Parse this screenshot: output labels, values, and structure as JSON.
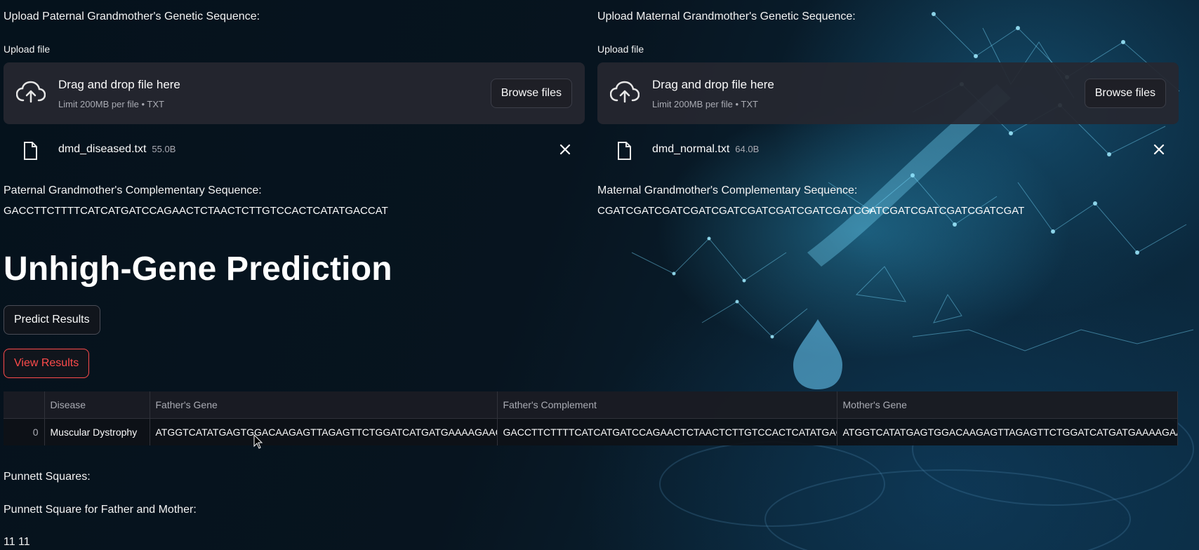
{
  "left": {
    "heading": "Upload Paternal Grandmother's Genetic Sequence:",
    "upload_label": "Upload file",
    "drop_title": "Drag and drop file here",
    "drop_sub": "Limit 200MB per file • TXT",
    "browse_label": "Browse files",
    "file_name": "dmd_diseased.txt",
    "file_size": "55.0B",
    "comp_label": "Paternal Grandmother's Complementary Sequence:",
    "comp_seq": "GACCTTCTTTTCATCATGATCCAGAACTCTAACTCTTGTCCACTCATATGACCAT"
  },
  "right": {
    "heading": "Upload Maternal Grandmother's Genetic Sequence:",
    "upload_label": "Upload file",
    "drop_title": "Drag and drop file here",
    "drop_sub": "Limit 200MB per file • TXT",
    "browse_label": "Browse files",
    "file_name": "dmd_normal.txt",
    "file_size": "64.0B",
    "comp_label": "Maternal Grandmother's Complementary Sequence:",
    "comp_seq": "CGATCGATCGATCGATCGATCGATCGATCGATCGATCGATCGATCGATCGATCGATCGAT"
  },
  "title": "Unhigh-Gene Prediction",
  "buttons": {
    "predict": "Predict Results",
    "view": "View Results"
  },
  "table": {
    "columns": [
      "",
      "Disease",
      "Father's Gene",
      "Father's Complement",
      "Mother's Gene"
    ],
    "rows": [
      [
        "0",
        "Muscular Dystrophy",
        "ATGGTCATATGAGTGGACAAGAGTTAGAGTTCTGGATCATGATGAAAAGAAGGTC",
        "GACCTTCTTTTCATCATGATCCAGAACTCTAACTCTTGTCCACTCATATGACCAT",
        "ATGGTCATATGAGTGGACAAGAGTTAGAGTTCTGGATCATGATGAAAAGAAGGTC"
      ]
    ]
  },
  "punnett": {
    "heading": "Punnett Squares:",
    "subheading": "Punnett Square for Father and Mother:",
    "value": "11 11"
  },
  "colors": {
    "accent_red": "#ff4b4b",
    "uploader_bg": "#262730",
    "glow": "#3cc8ff"
  }
}
